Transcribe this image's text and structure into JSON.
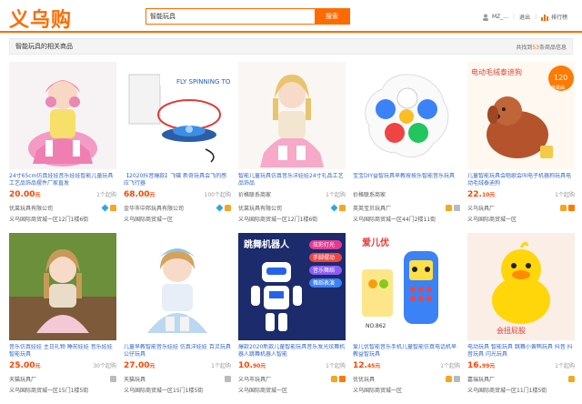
{
  "header": {
    "logo": "义乌购",
    "search_value": "智能玩具",
    "search_button": "搜索",
    "user_name": "MZ_...",
    "logout": "退出",
    "ranking": "排行榜"
  },
  "results_bar": {
    "title": "智能玩具的相关商品",
    "count_prefix": "共找到",
    "count_num": "53",
    "count_suffix": "条商品信息"
  },
  "colors": {
    "accent": "#ff6a00",
    "price": "#ff4400",
    "link": "#3366cc"
  },
  "products": [
    {
      "name": "24寸65cm仿真娃娃音乐娃娃智能儿童玩具工艺品饰品摆件厂家直发",
      "price_int": "20.00",
      "price_unit": "元",
      "moq": "1个起购",
      "shop": "优莱玩具有限公司",
      "badges": [
        "diamond",
        "crown"
      ],
      "address": "义乌国际商贸城一区12门1楼6街"
    },
    {
      "name": "【2020抖音爆款】飞碟 新奇玩具会飞的感应飞行器",
      "price_int": "68.00",
      "price_unit": "元",
      "moq": "100个起购",
      "shop": "金华市中邦玩具有限公司",
      "badges": [
        "diamond",
        "crown"
      ],
      "address": "义乌国际商贸城一区"
    },
    {
      "name": "智能儿童玩具仿真音乐洋娃娃24寸礼品工艺品饰品",
      "price_int": "价格",
      "price_unit": "联系商家",
      "moq": "1个起购",
      "shop": "优莱玩具有限公司",
      "badges": [
        "diamond",
        "crown"
      ],
      "address": "义乌国际商贸城一区12门1楼6街"
    },
    {
      "name": "宝宝DIY益智玩具早教按按乐智能音乐玩具",
      "price_int": "价格",
      "price_unit": "联系商家",
      "moq": "",
      "shop": "英英宝贝玩具厂",
      "badges": [
        "crown",
        "gray"
      ],
      "address": "义乌国际商贸城一区44门2楼11街"
    },
    {
      "name": "儿童智能玩具会唱歌会叫电子机器狗玩具电动毛绒泰迪狗",
      "price_int": "22.",
      "price_unit": "10元",
      "moq": "1个起购",
      "shop": "义乌玩具厂",
      "badges": [
        "crown",
        "orange"
      ],
      "address": "义乌国际商贸城一区"
    },
    {
      "name": "音乐仿真娃娃 主日礼物 睡前娃娃 音乐娃娃 智能玩具",
      "price_int": "25.00",
      "price_unit": "元",
      "moq": "30个起购",
      "shop": "天猫玩具厂",
      "badges": [
        "gray"
      ],
      "address": "义乌国际商贸城一区15门1楼5街"
    },
    {
      "name": "儿童早教智能音乐娃娃 仿真洋娃娃 百灵玩具 公仔玩具",
      "price_int": "27.00",
      "price_unit": "元",
      "moq": "1个起购",
      "shop": "天猫玩具",
      "badges": [
        "gray"
      ],
      "address": "义乌国际商贸城一区15门1楼5街"
    },
    {
      "name": "爆款2020新款儿童智能玩具音乐发光炫舞机器人跳舞机器人智能",
      "price_int": "10.",
      "price_unit": "90元",
      "moq": "1个起购",
      "shop": "义乌市玩具厂",
      "badges": [
        "crown",
        "orange"
      ],
      "address": "义乌国际商贸城一区"
    },
    {
      "name": "爱儿优智能音乐手机儿童智能仿真电话机早教益智玩具",
      "price_int": "12.",
      "price_unit": "45元",
      "moq": "1个起购",
      "shop": "优优玩具",
      "badges": [
        "crown",
        "gray"
      ],
      "address": "义乌国际商贸城一区"
    },
    {
      "name": "电动玩具 智能玩具 跳舞小黄鸭玩具 抖音 抖音玩具 闪光玩具",
      "price_int": "16.",
      "price_unit": "99元",
      "moq": "1个起购",
      "shop": "嘉瑞玩具厂",
      "badges": [
        "crown"
      ],
      "address": "义乌国际商贸城一区11门1楼5街"
    }
  ],
  "image_text": {
    "p2_banner": "FLY SPINNING TOP",
    "p5_banner": "电动毛绒泰迪狗",
    "p5_price": "120",
    "p5_sub": "首歌曲",
    "p8_title": "跳舞机器人",
    "p8_lines": [
      "炫彩灯光",
      "手脚摆动",
      "音乐舞蹈",
      "舞蹈表演"
    ],
    "p9_brand": "爱儿优",
    "p9_tag": "NO.862",
    "p10_text": "会扭屁股"
  }
}
